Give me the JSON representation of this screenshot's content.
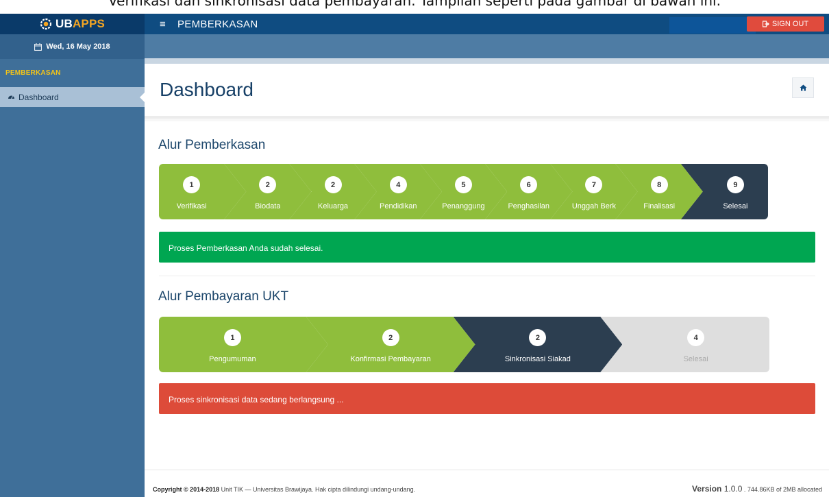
{
  "caption": "Verifikasi dan sinkronisasi data pembayaran. Tampilan seperti pada gambar di bawah ini.",
  "header": {
    "logo_ub": "UB",
    "logo_apps": "APPS",
    "section_title": "PEMBERKASAN",
    "signout_label": "SIGN OUT"
  },
  "sidebar": {
    "date": "Wed, 16 May 2018",
    "section_header": "PEMBERKASAN",
    "items": [
      {
        "label": "Dashboard"
      }
    ]
  },
  "main": {
    "page_title": "Dashboard",
    "sec1_title": "Alur Pemberkasan",
    "sec2_title": "Alur Pembayaran UKT",
    "alert1": "Proses Pemberkasan Anda sudah selesai.",
    "alert2": "Proses sinkronisasi data sedang berlangsung ..."
  },
  "steps1": [
    {
      "num": "1",
      "label": "Verifikasi",
      "state": "done"
    },
    {
      "num": "2",
      "label": "Biodata",
      "state": "done"
    },
    {
      "num": "2",
      "label": "Keluarga",
      "state": "done"
    },
    {
      "num": "4",
      "label": "Pendidikan",
      "state": "done"
    },
    {
      "num": "5",
      "label": "Penanggung",
      "state": "done"
    },
    {
      "num": "6",
      "label": "Penghasilan",
      "state": "done"
    },
    {
      "num": "7",
      "label": "Unggah Berk",
      "state": "done"
    },
    {
      "num": "8",
      "label": "Finalisasi",
      "state": "done"
    },
    {
      "num": "9",
      "label": "Selesai",
      "state": "active"
    }
  ],
  "steps2": [
    {
      "num": "1",
      "label": "Pengumuman",
      "state": "done"
    },
    {
      "num": "2",
      "label": "Konfirmasi Pembayaran",
      "state": "done"
    },
    {
      "num": "2",
      "label": "Sinkronisasi Siakad",
      "state": "active"
    },
    {
      "num": "4",
      "label": "Selesai",
      "state": "pending"
    }
  ],
  "colors": {
    "done": "#8fbe3c",
    "active": "#2c3e50",
    "pending": "#dedede",
    "success": "#00a651",
    "danger": "#dd4b39"
  },
  "footer": {
    "copyright_bold": "Copyright © 2014-2018",
    "copyright_rest": " Unit TIK — Universitas Brawijaya. Hak cipta dilindungi undang-undang.",
    "version_label": "Version",
    "version_num": " 1.0.0",
    "memory": " . 744.86KB of 2MB allocated"
  }
}
